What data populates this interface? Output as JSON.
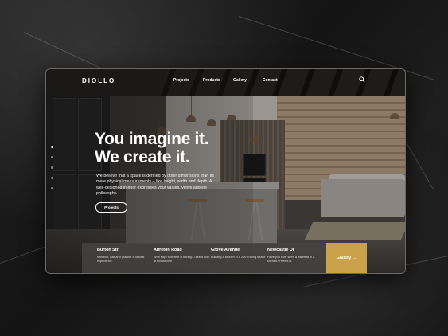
{
  "brand": {
    "logo": "DIOLLO"
  },
  "nav": {
    "items": [
      {
        "label": "Projects"
      },
      {
        "label": "Products"
      },
      {
        "label": "Gallery"
      },
      {
        "label": "Contact"
      }
    ]
  },
  "icons": {
    "search": "search-icon"
  },
  "hero": {
    "headline_line1": "You imagine it.",
    "headline_line2": "We create it.",
    "body": "We believe that a space is defined by other dimensions than its mere physical measurements – like height, width and depth. A well-designed interior expresses your values, views and life philosophy.",
    "cta_label": "Projects"
  },
  "slider": {
    "count": 5,
    "active": 0
  },
  "cards": [
    {
      "title": "Burton Str.",
      "desc": "Bamboo, oak and granite: a natural experience"
    },
    {
      "title": "Alfreton Road",
      "desc": "Who says concrete is boring? Take a look at this kitchen"
    },
    {
      "title": "Grove Avenue",
      "desc": "Building a kitchen in a 200 ft living space"
    },
    {
      "title": "Newcastle Dr",
      "desc": "Have you ever seen a waterfall in a kitchen? Here it is."
    }
  ],
  "gallery_cta": {
    "label": "Gallery →"
  },
  "colors": {
    "accent": "#c9a24a",
    "frame_bg": "#3a3633",
    "text": "#ffffff"
  }
}
